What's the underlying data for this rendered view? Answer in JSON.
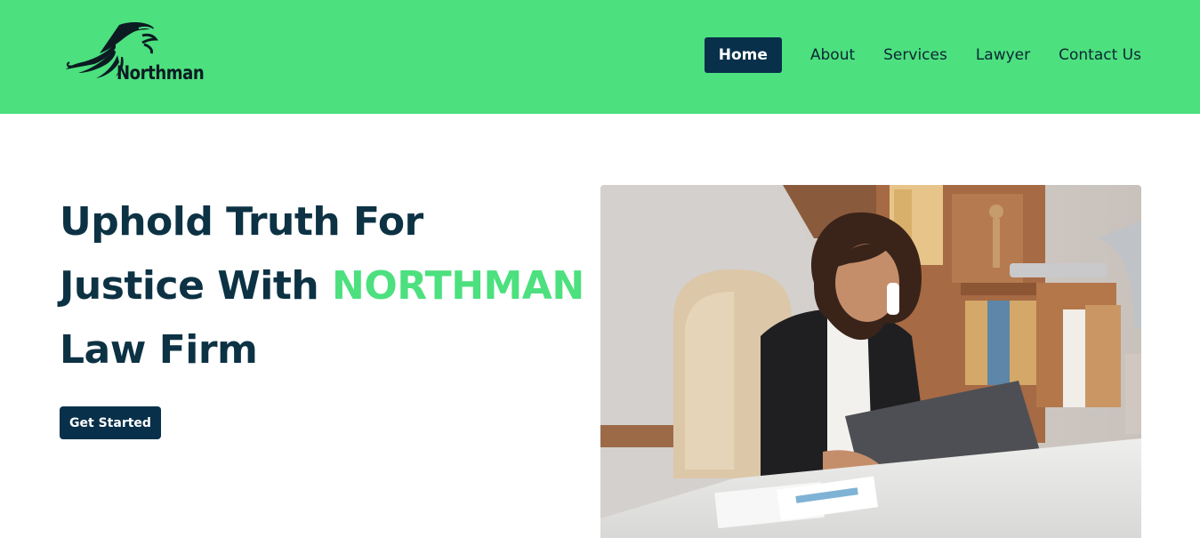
{
  "brand": {
    "name": "Northman"
  },
  "nav": {
    "items": [
      {
        "label": "Home",
        "active": true
      },
      {
        "label": "About",
        "active": false
      },
      {
        "label": "Services",
        "active": false
      },
      {
        "label": "Lawyer",
        "active": false
      },
      {
        "label": "Contact Us",
        "active": false
      }
    ]
  },
  "hero": {
    "title_line1": "Uphold Truth For",
    "title_line2_prefix": "Justice With ",
    "title_line2_accent": "NORTHMAN",
    "title_line3": "Law Firm",
    "cta_label": "Get Started",
    "image_alt": "Lawyer working at a laptop while on the phone in an office"
  },
  "colors": {
    "header_bg": "#4ce07f",
    "navy": "#08304a",
    "heading": "#0c3244",
    "accent": "#4ce07f"
  }
}
